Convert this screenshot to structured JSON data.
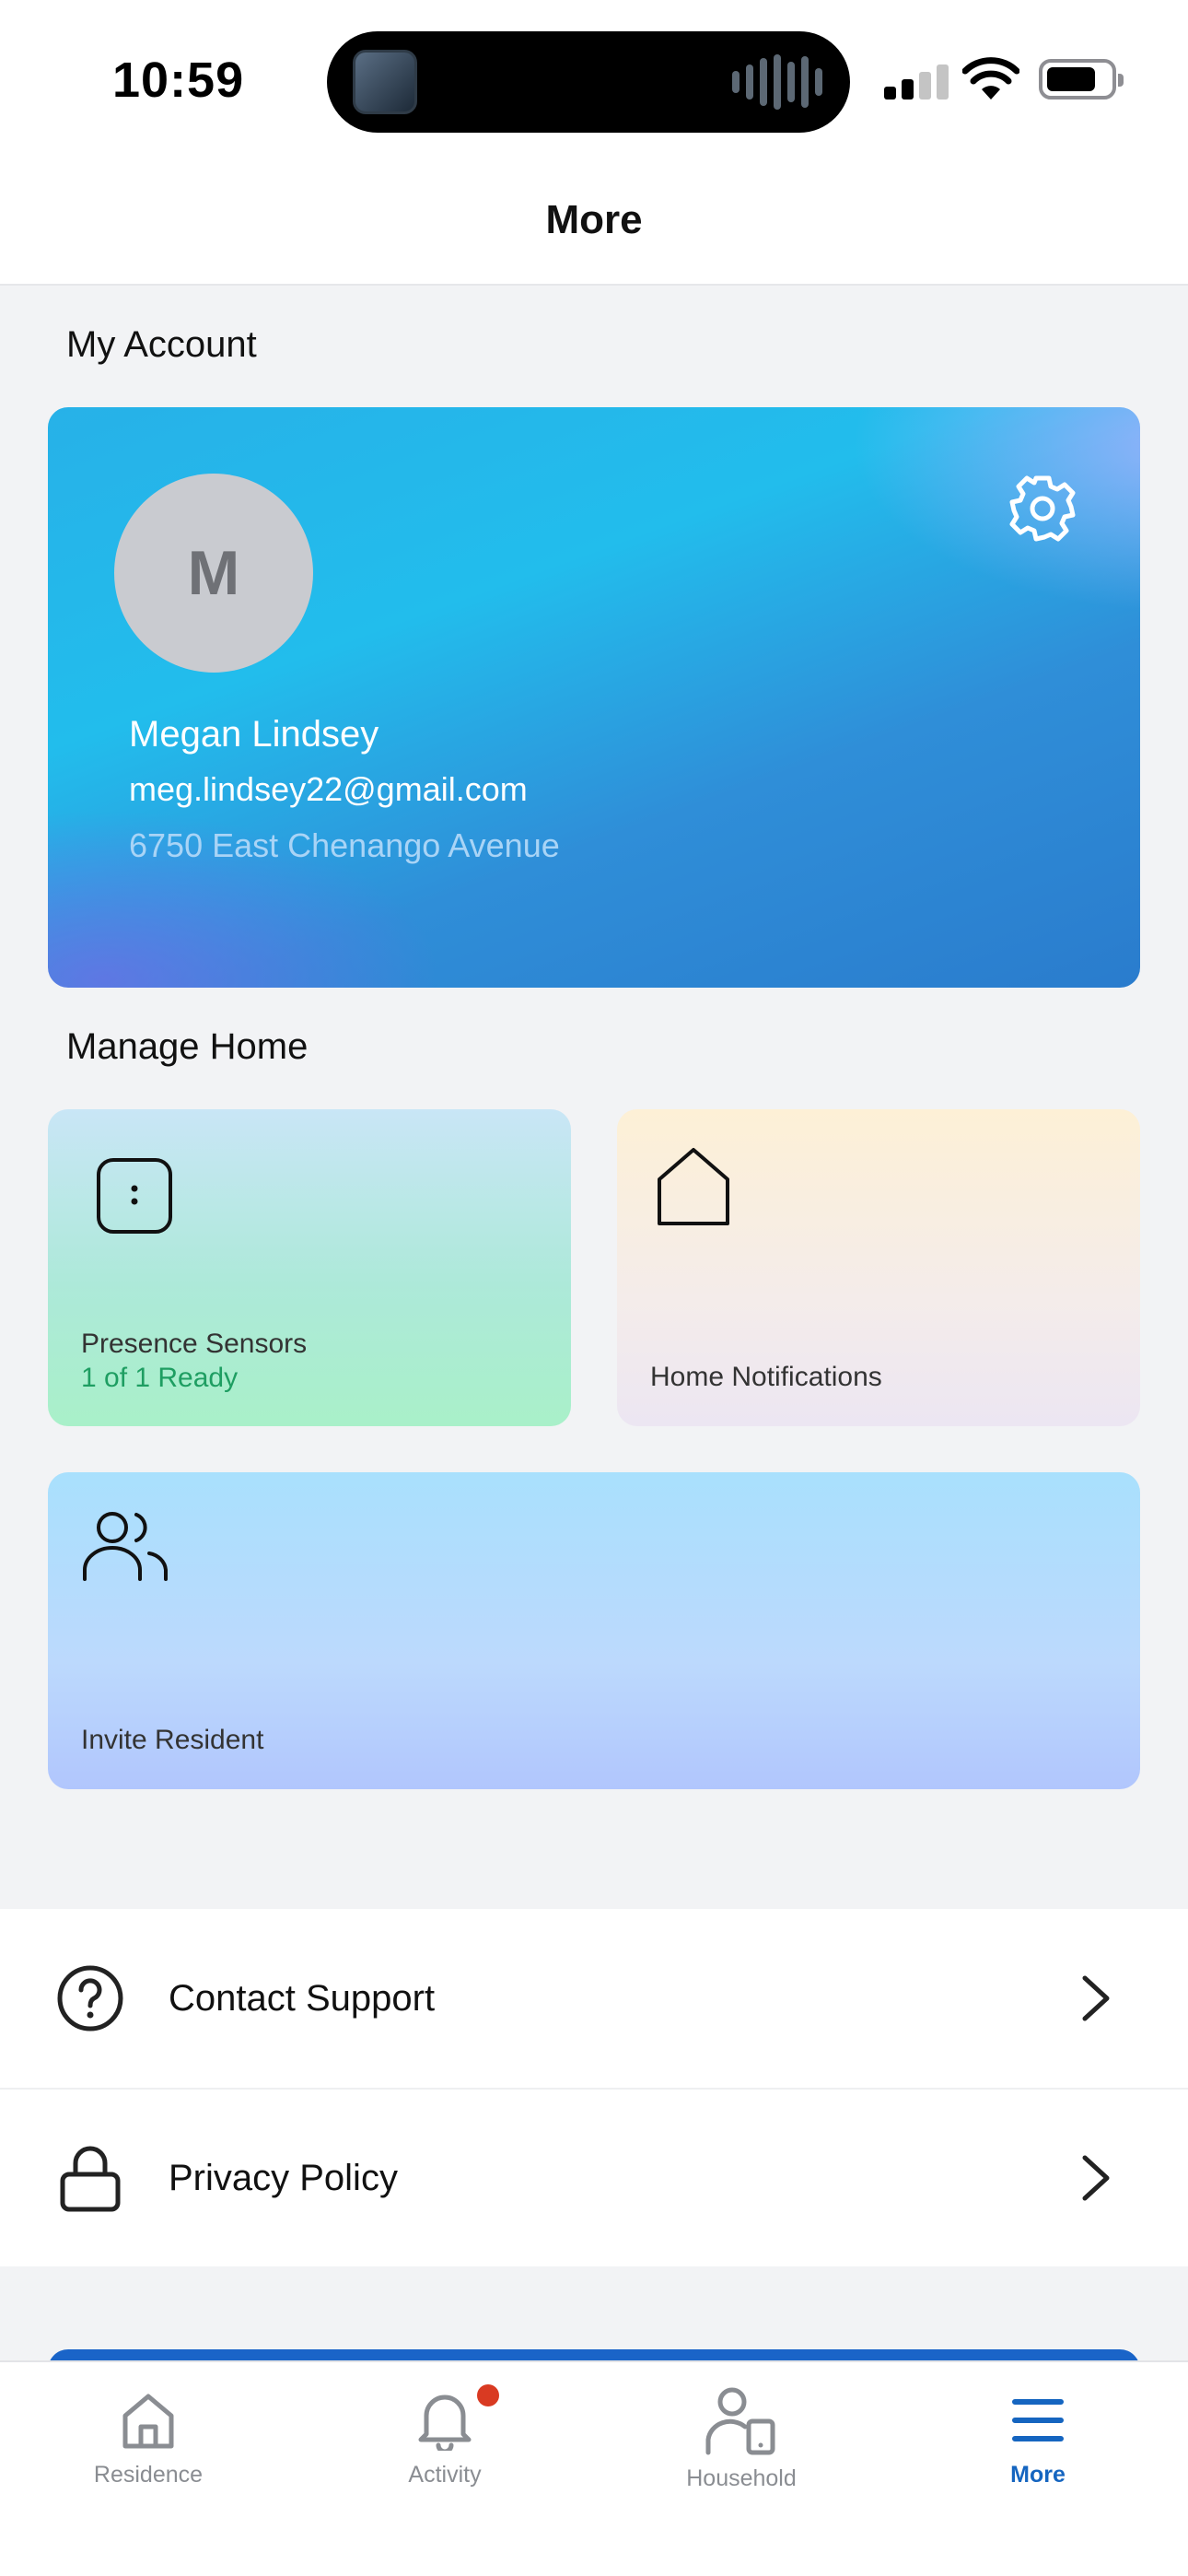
{
  "status_bar": {
    "time": "10:59"
  },
  "header": {
    "title": "More"
  },
  "account": {
    "section_title": "My Account",
    "avatar_initial": "M",
    "name": "Megan Lindsey",
    "email": "meg.lindsey22@gmail.com",
    "address": "6750 East Chenango Avenue",
    "settings_icon": "gear-icon"
  },
  "manage_home": {
    "section_title": "Manage Home",
    "tiles": [
      {
        "label": "Presence Sensors",
        "status": "1 of 1 Ready",
        "icon": "presence-sensor-icon"
      },
      {
        "label": "Home Notifications",
        "icon": "house-icon"
      },
      {
        "label": "Invite Resident",
        "icon": "users-icon"
      }
    ]
  },
  "menu": [
    {
      "label": "Contact Support",
      "icon": "question-circle-icon"
    },
    {
      "label": "Privacy Policy",
      "icon": "lock-icon"
    }
  ],
  "tab_bar": {
    "tabs": [
      {
        "label": "Residence",
        "icon": "home-icon"
      },
      {
        "label": "Activity",
        "icon": "bell-icon",
        "has_badge": true
      },
      {
        "label": "Household",
        "icon": "person-device-icon"
      },
      {
        "label": "More",
        "icon": "menu-icon",
        "active": true
      }
    ]
  },
  "colors": {
    "accent": "#1565c0",
    "success": "#1e9e62",
    "badge": "#d93a22"
  }
}
